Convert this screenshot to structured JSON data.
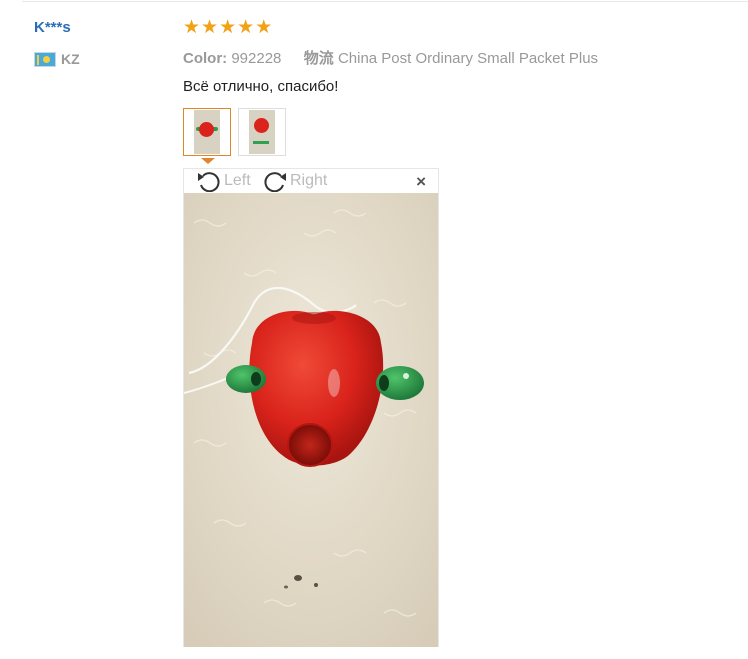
{
  "reviewer": {
    "name": "K***s",
    "country_code": "KZ",
    "flag_icon": "kz-flag-icon"
  },
  "rating": {
    "stars": 5,
    "max": 5,
    "color": "#f2a216"
  },
  "meta": {
    "color_key": "Color:",
    "color_value": "992228",
    "shipping_key": "物流",
    "shipping_value": "China Post Ordinary Small Packet Plus"
  },
  "review_text": "Всё отлично, спасибо!",
  "thumbnails": [
    {
      "name": "thumbnail-1",
      "active": true
    },
    {
      "name": "thumbnail-2",
      "active": false
    }
  ],
  "viewer": {
    "rotate_left_label": "Left",
    "rotate_right_label": "Right",
    "close_label": "×",
    "icons": [
      "rotate-left-icon",
      "rotate-right-icon",
      "close-icon"
    ]
  },
  "colors": {
    "accent": "#e0862a",
    "link": "#2a6db8",
    "muted": "#999999"
  }
}
